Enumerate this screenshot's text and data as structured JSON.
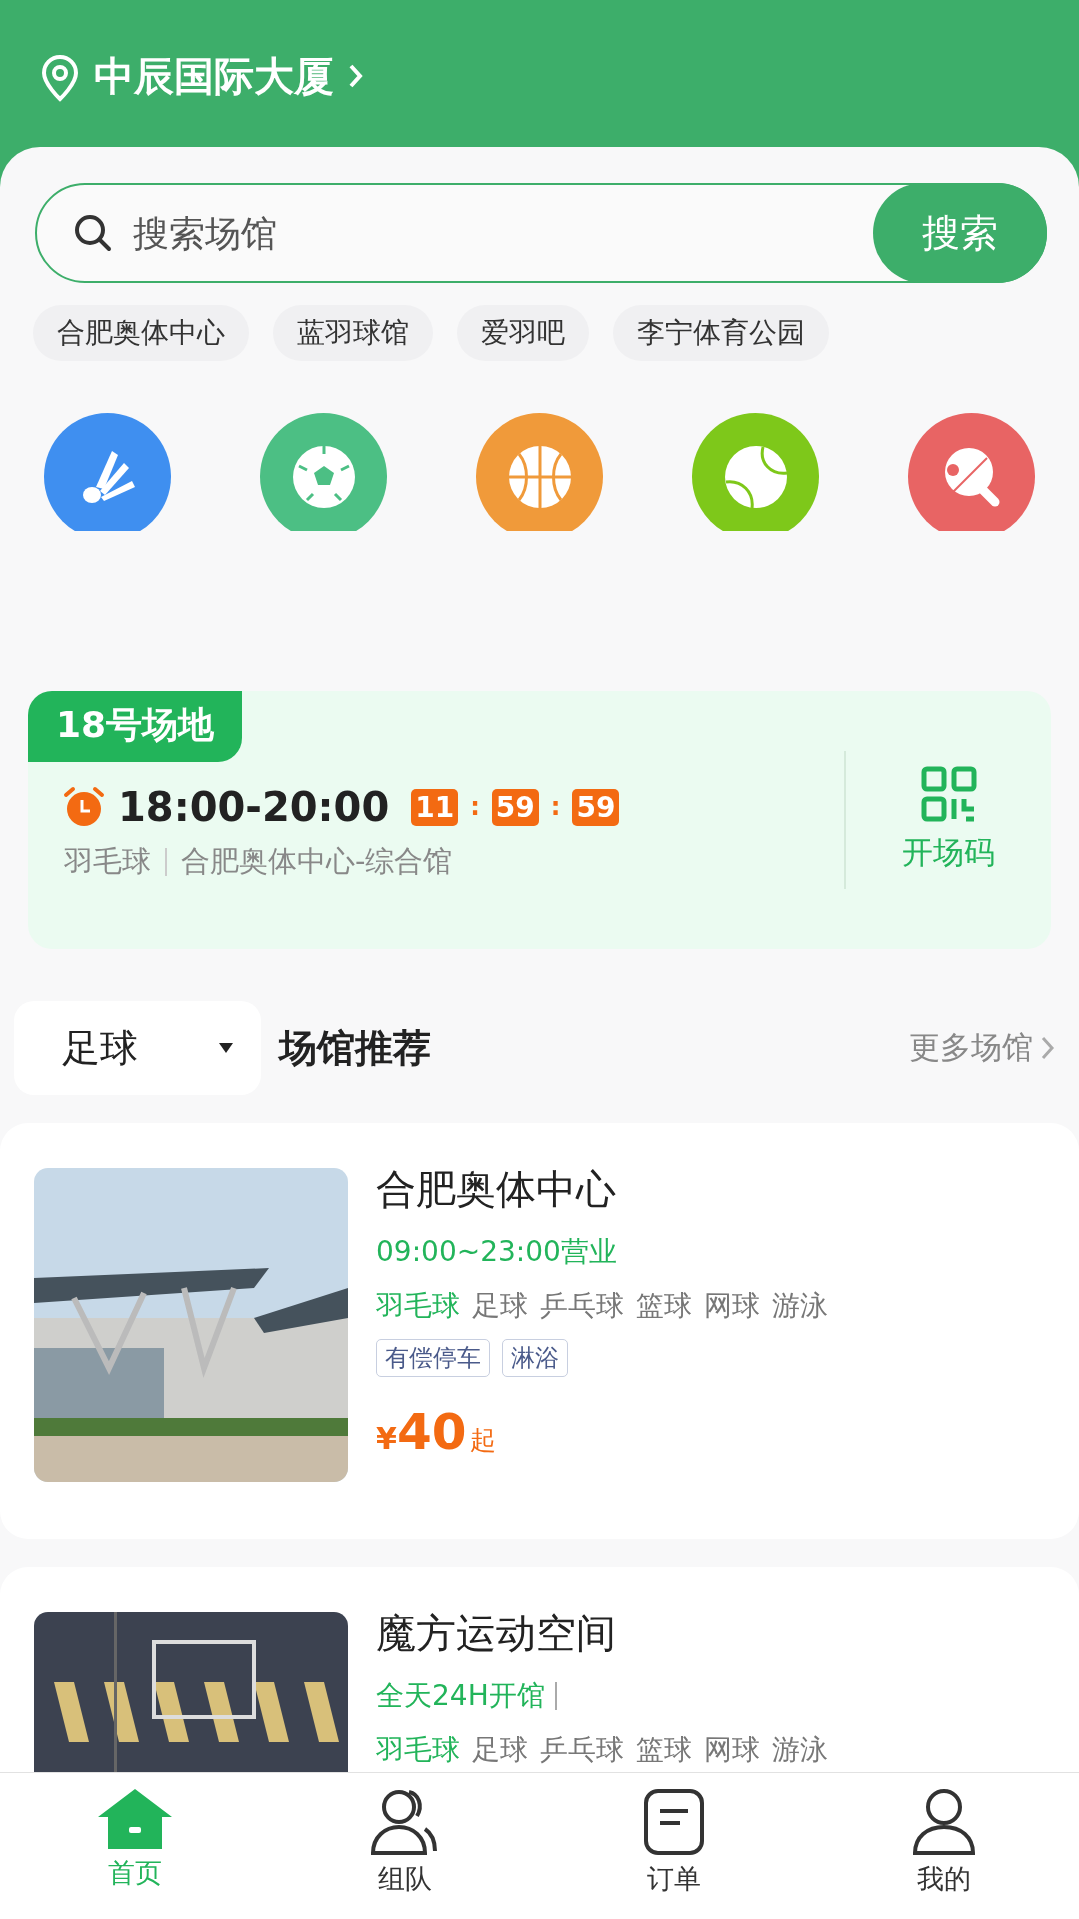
{
  "location": {
    "name": "中辰国际大厦"
  },
  "search": {
    "placeholder": "搜索场馆",
    "button": "搜索"
  },
  "hot_searches": [
    "合肥奥体中心",
    "蓝羽球馆",
    "爱羽吧",
    "李宁体育公园"
  ],
  "sports": [
    {
      "kind": "badminton",
      "color": "#3f8ff0"
    },
    {
      "kind": "football",
      "color": "#4cbf84"
    },
    {
      "kind": "basketball",
      "color": "#f09a3a"
    },
    {
      "kind": "tennis",
      "color": "#7ec81a"
    },
    {
      "kind": "pingpong",
      "color": "#e86464"
    }
  ],
  "booking": {
    "court": "18号场地",
    "time": "18:00-20:00",
    "countdown": [
      "11",
      "59",
      "59"
    ],
    "countdown_separator": ":",
    "sport": "羽毛球",
    "venue": "合肥奥体中心-综合馆",
    "code_label": "开场码"
  },
  "section": {
    "filter": "足球",
    "title": "场馆推荐",
    "more": "更多场馆"
  },
  "venues": [
    {
      "name": "合肥奥体中心",
      "picture": {
        "kind": "picture"
      },
      "hours": "09:00~23:00营业",
      "hours_divider": false,
      "sports": [
        {
          "label": "羽毛球",
          "selected": true
        },
        {
          "label": "足球",
          "selected": false
        },
        {
          "label": "乒乓球",
          "selected": false
        },
        {
          "label": "篮球",
          "selected": false
        },
        {
          "label": "网球",
          "selected": false
        },
        {
          "label": "游泳",
          "selected": false
        }
      ],
      "tags": [
        "有偿停车",
        "淋浴"
      ],
      "price": {
        "currency": "¥",
        "amount": "40",
        "suffix": "起"
      }
    },
    {
      "name": "魔方运动空间",
      "picture": {
        "kind": "picture"
      },
      "hours": "全天24H开馆",
      "hours_divider": true,
      "sports": [
        {
          "label": "羽毛球",
          "selected": true
        },
        {
          "label": "足球",
          "selected": false
        },
        {
          "label": "乒乓球",
          "selected": false
        },
        {
          "label": "篮球",
          "selected": false
        },
        {
          "label": "网球",
          "selected": false
        },
        {
          "label": "游泳",
          "selected": false
        }
      ]
    }
  ],
  "tab_bar": [
    {
      "kind": "home",
      "label": "首页",
      "selected": true
    },
    {
      "kind": "team",
      "label": "组队",
      "selected": false
    },
    {
      "kind": "orders",
      "label": "订单",
      "selected": false
    },
    {
      "kind": "profile",
      "label": "我的",
      "selected": false
    }
  ]
}
